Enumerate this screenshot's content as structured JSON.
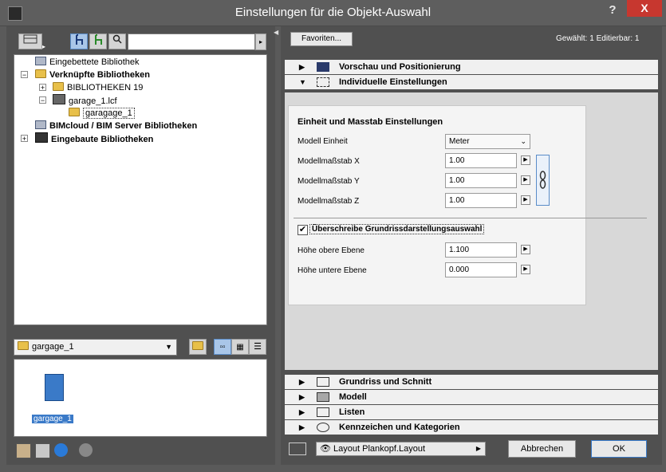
{
  "window": {
    "title": "Einstellungen für die Objekt-Auswahl",
    "help_label": "?",
    "close_label": "X"
  },
  "left": {
    "search": {
      "value": "",
      "placeholder": ""
    },
    "tree": [
      {
        "label": "Eingebettete Bibliothek",
        "bold": false
      },
      {
        "label": "Verknüpfte Bibliotheken",
        "bold": true
      },
      {
        "label": "BIBLIOTHEKEN 19",
        "bold": false
      },
      {
        "label": "garage_1.lcf",
        "bold": false
      },
      {
        "label": "garagage_1",
        "bold": false
      },
      {
        "label": "BIMcloud / BIM Server Bibliotheken",
        "bold": true
      },
      {
        "label": "Eingebaute Bibliotheken",
        "bold": true
      }
    ],
    "folder_select": "gargage_1",
    "preview_item": "gargage_1"
  },
  "right": {
    "favorites_label": "Favoriten...",
    "status": "Gewählt: 1 Editierbar: 1",
    "sections_top": [
      {
        "label": "Vorschau und Positionierung",
        "expanded": false
      },
      {
        "label": "Individuelle Einstellungen",
        "expanded": true
      }
    ],
    "settings": {
      "heading": "Einheit und Masstab Einstellungen",
      "model_unit_label": "Modell Einheit",
      "model_unit_value": "Meter",
      "scale_x_label": "Modellmaßstab X",
      "scale_x_value": "1.00",
      "scale_y_label": "Modellmaßstab Y",
      "scale_y_value": "1.00",
      "scale_z_label": "Modellmaßstab Z",
      "scale_z_value": "1.00",
      "override_label": "Überschreibe Grundrissdarstellungsauswahl",
      "override_checked": true,
      "upper_label": "Höhe obere Ebene",
      "upper_value": "1.100",
      "lower_label": "Höhe untere Ebene",
      "lower_value": "0.000"
    },
    "sections_bottom": [
      {
        "label": "Grundriss und Schnitt"
      },
      {
        "label": "Modell"
      },
      {
        "label": "Listen"
      },
      {
        "label": "Kennzeichen und Kategorien"
      }
    ],
    "layout_select": "Layout Plankopf.Layout",
    "cancel_label": "Abbrechen",
    "ok_label": "OK"
  }
}
